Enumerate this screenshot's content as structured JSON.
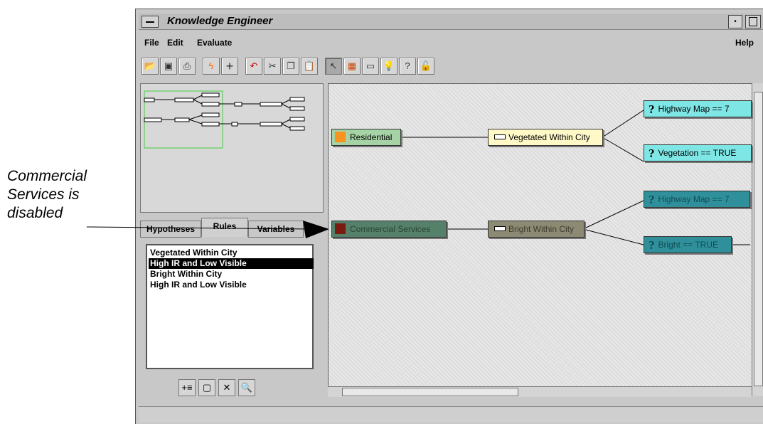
{
  "annotation": {
    "lines": [
      "Commercial",
      "Services is",
      "disabled"
    ]
  },
  "window": {
    "title": "Knowledge Engineer"
  },
  "menu": {
    "file": "File",
    "edit": "Edit",
    "evaluate": "Evaluate",
    "help": "Help"
  },
  "tabs": {
    "hypotheses": "Hypotheses",
    "rules": "Rules",
    "variables": "Variables"
  },
  "rules_list": {
    "items": [
      {
        "label": "Vegetated Within City"
      },
      {
        "label": "High IR and Low Visible"
      },
      {
        "label": "Bright Within City"
      },
      {
        "label": "High IR and Low Visible"
      }
    ]
  },
  "nodes": {
    "residential": "Residential",
    "commercial": "Commercial Services",
    "vegetated_rule": "Vegetated Within City",
    "bright_rule": "Bright Within City",
    "highway1": "Highway Map == 7",
    "vegetation": "Vegetation == TRUE",
    "highway2": "Highway Map == 7",
    "bright": "Bright == TRUE"
  },
  "colors": {
    "residential_node": "#a6d3a6",
    "residential_icon": "#f7931e",
    "commercial_node": "#55806a",
    "commercial_icon": "#7a1a10",
    "rule_enabled": "#fff9c8",
    "rule_disabled": "#8c8a72",
    "variable_enabled": "#7fe6e6",
    "variable_disabled": "#2f8f9a"
  },
  "icons": {
    "toolbar": [
      "open-folder-icon",
      "save-icon",
      "print-icon",
      "lightning-icon",
      "plus-icon",
      "undo-icon",
      "cut-icon",
      "copy-icon",
      "paste-icon",
      "pointer-icon",
      "color-legend-icon",
      "rule-icon",
      "lightbulb-icon",
      "lightbulb-question-icon",
      "lock-icon"
    ],
    "bottom": [
      "add-list-icon",
      "frame-icon",
      "delete-icon",
      "find-icon"
    ]
  }
}
